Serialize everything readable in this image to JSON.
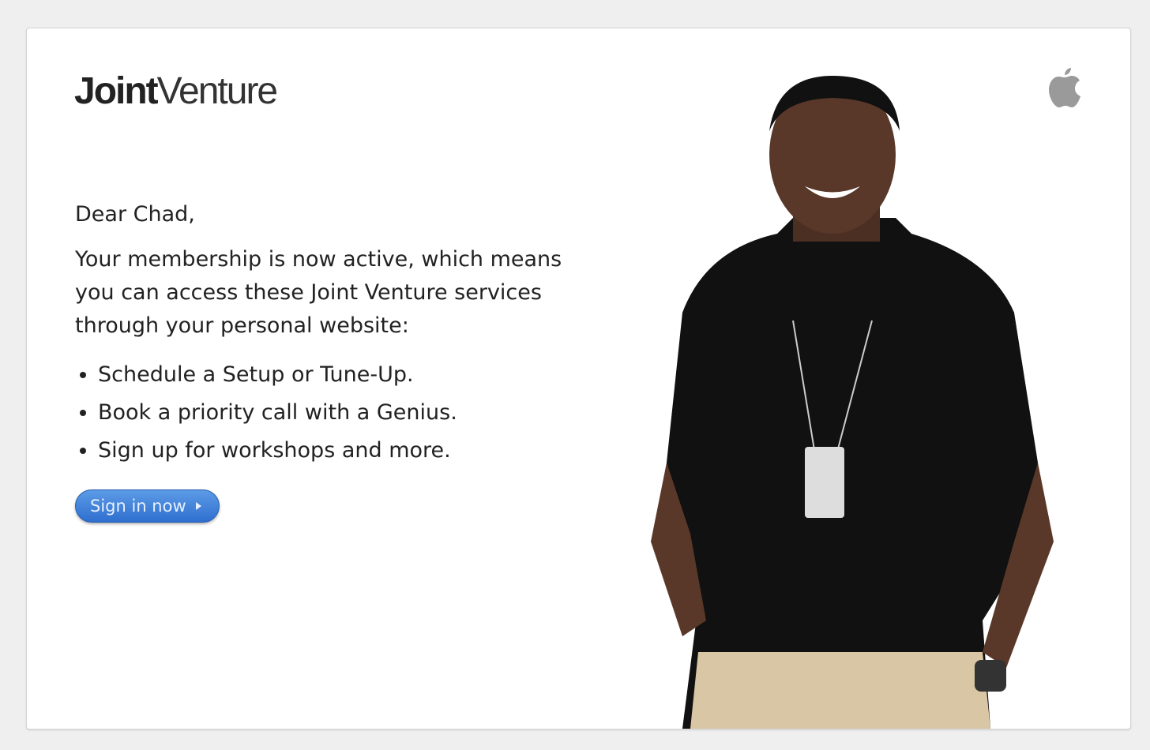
{
  "logo": {
    "bold": "Joint",
    "light": "Venture"
  },
  "greeting": "Dear Chad,",
  "message": "Your membership is now active, which means you can access these Joint Venture services through your personal website:",
  "services": [
    "Schedule a Setup or Tune-Up.",
    "Book a priority call with a Genius.",
    "Sign up for workshops and more."
  ],
  "cta_label": "Sign in now",
  "colors": {
    "button": "#3a7bd8",
    "background": "#efefef",
    "apple_logo": "#999999"
  }
}
